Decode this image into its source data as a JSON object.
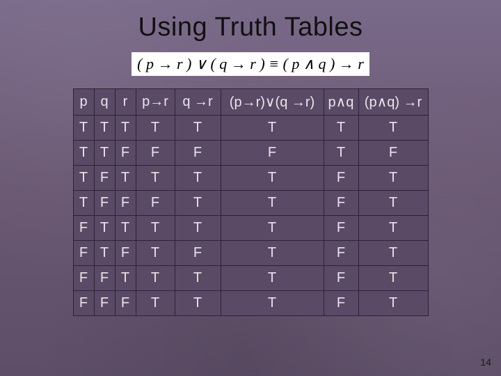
{
  "title": "Using Truth Tables",
  "equation": "( p → r ) ∨ ( q → r ) ≡ ( p ∧ q ) → r",
  "page_number": "14",
  "headers": [
    "p",
    "q",
    "r",
    "p→r",
    "q →r",
    "(p→r)∨(q →r)",
    "p∧q",
    "(p∧q) →r"
  ],
  "chart_data": {
    "type": "table",
    "title": "Truth table for (p→r)∨(q→r) ≡ (p∧q)→r",
    "columns": [
      "p",
      "q",
      "r",
      "p→r",
      "q→r",
      "(p→r)∨(q→r)",
      "p∧q",
      "(p∧q)→r"
    ],
    "rows": [
      [
        "T",
        "T",
        "T",
        "T",
        "T",
        "T",
        "T",
        "T"
      ],
      [
        "T",
        "T",
        "F",
        "F",
        "F",
        "F",
        "T",
        "F"
      ],
      [
        "T",
        "F",
        "T",
        "T",
        "T",
        "T",
        "F",
        "T"
      ],
      [
        "T",
        "F",
        "F",
        "F",
        "T",
        "T",
        "F",
        "T"
      ],
      [
        "F",
        "T",
        "T",
        "T",
        "T",
        "T",
        "F",
        "T"
      ],
      [
        "F",
        "T",
        "F",
        "T",
        "F",
        "T",
        "F",
        "T"
      ],
      [
        "F",
        "F",
        "T",
        "T",
        "T",
        "T",
        "F",
        "T"
      ],
      [
        "F",
        "F",
        "F",
        "T",
        "T",
        "T",
        "F",
        "T"
      ]
    ]
  }
}
